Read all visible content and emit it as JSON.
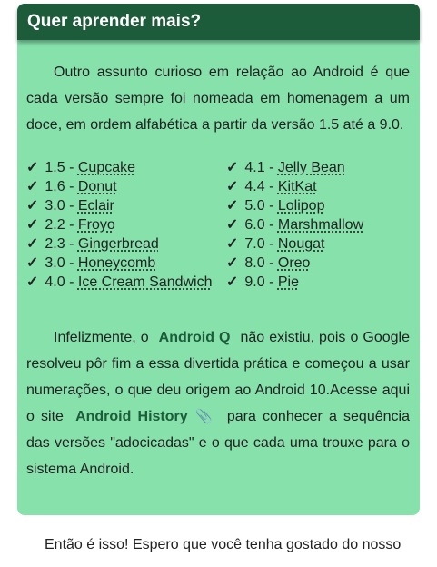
{
  "card": {
    "title": "Quer aprender mais?",
    "intro": "Outro assunto curioso em relação ao Android é que cada versão sempre foi nomeada em homenagem a um doce, em ordem alfabética a partir da versão 1.5 até a 9.0.",
    "check_symbol": "✓",
    "versions_left": [
      {
        "version": "1.5 - ",
        "name": "Cupcake"
      },
      {
        "version": "1.6 - ",
        "name": "Donut"
      },
      {
        "version": "3.0 - ",
        "name": "Eclair"
      },
      {
        "version": "2.2 - ",
        "name": "Froyo"
      },
      {
        "version": "2.3 - ",
        "name": "Gingerbread"
      },
      {
        "version": "3.0 - ",
        "name": "Honeycomb"
      },
      {
        "version": "4.0 - ",
        "name": "Ice Cream Sandwich"
      }
    ],
    "versions_right": [
      {
        "version": "4.1 - ",
        "name": "Jelly Bean"
      },
      {
        "version": "4.4 - ",
        "name": "KitKat"
      },
      {
        "version": "5.0 - ",
        "name": "Lolipop"
      },
      {
        "version": "6.0 - ",
        "name": "Marshmallow"
      },
      {
        "version": "7.0 - ",
        "name": "Nougat"
      },
      {
        "version": "8.0 - ",
        "name": "Oreo"
      },
      {
        "version": "9.0 - ",
        "name": "Pie"
      }
    ],
    "para2": {
      "part1": "Infelizmente, o",
      "highlight": "Android Q",
      "part2": "não existiu, pois o Google resolveu pôr fim a essa divertida prática e começou a usar numerações, o que deu origem ao Android 10.Acesse aqui o site",
      "link_label": "Android History",
      "link_icon": "paperclip-icon",
      "part3": "para conhecer a sequência das versões \"adocicadas\" e o que cada uma trouxe para o sistema Android."
    }
  },
  "outro": "Então é isso! Espero que você tenha gostado do nosso",
  "colors": {
    "card_bg": "#86e1ab",
    "header_bg": "#1c5c3a",
    "accent": "#1c5c3a"
  }
}
